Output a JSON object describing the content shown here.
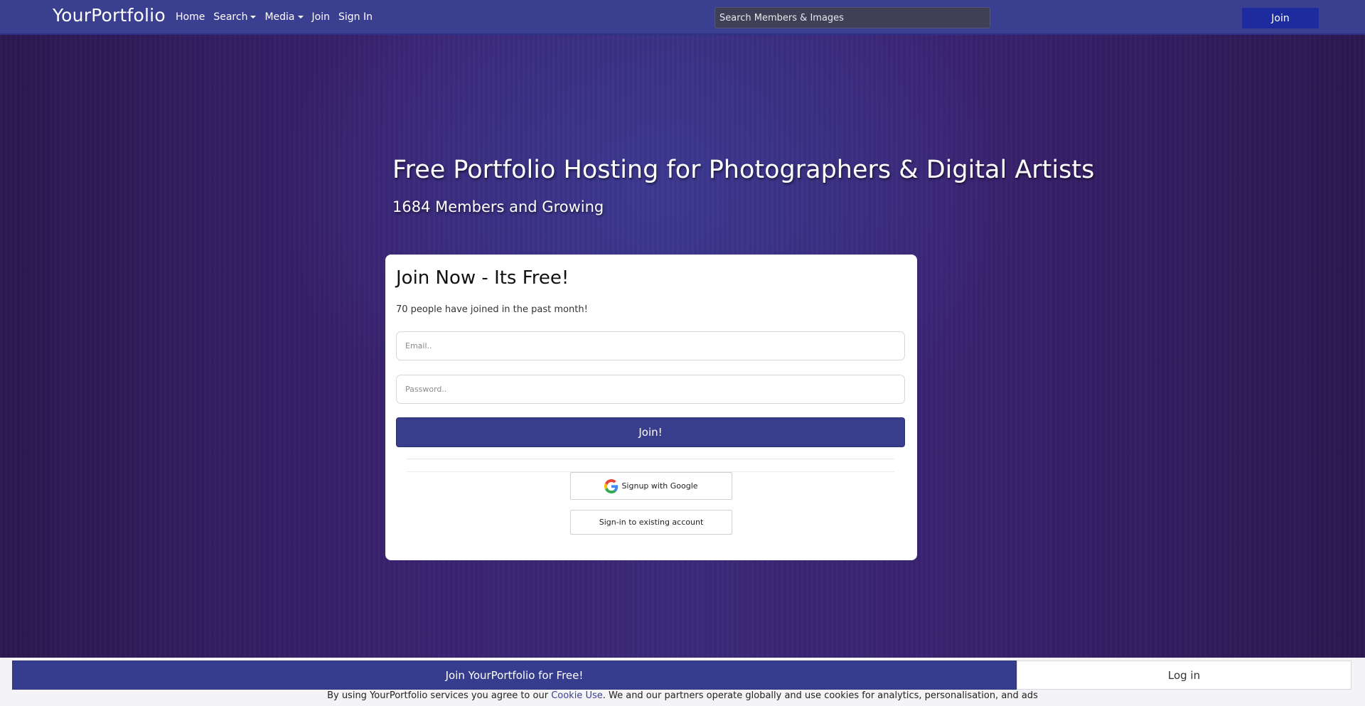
{
  "navbar": {
    "brand": "YourPortfolio",
    "links": [
      {
        "label": "Home",
        "dropdown": false
      },
      {
        "label": "Search",
        "dropdown": true
      },
      {
        "label": "Media",
        "dropdown": true
      },
      {
        "label": "Join",
        "dropdown": false
      },
      {
        "label": "Sign In",
        "dropdown": false
      }
    ],
    "search_placeholder": "Search Members & Images",
    "join_label": "Join"
  },
  "hero": {
    "title": "Free Portfolio Hosting for Photographers & Digital Artists",
    "subtitle": "1684 Members and Growing"
  },
  "signup_card": {
    "title": "Join Now - Its Free!",
    "note": "70 people have joined in the past month!",
    "email_placeholder": "Email..",
    "password_placeholder": "Password..",
    "submit_label": "Join!",
    "google_label": "Signup with Google",
    "signin_label": "Sign-in to existing account"
  },
  "bottom_bar": {
    "join_label": "Join YourPortfolio for Free!",
    "login_label": "Log in",
    "cookie_prefix": "By using YourPortfolio services you agree to our ",
    "cookie_link": "Cookie Use",
    "cookie_suffix": ". We and our partners operate globally and use cookies for analytics, personalisation, and ads"
  },
  "colors": {
    "navbar": "#3a3f8f",
    "primary_button": "#383d8c",
    "nav_join_button": "#1e2b9e",
    "hero_dark": "#2c1850",
    "hero_light": "#3a2a78"
  }
}
